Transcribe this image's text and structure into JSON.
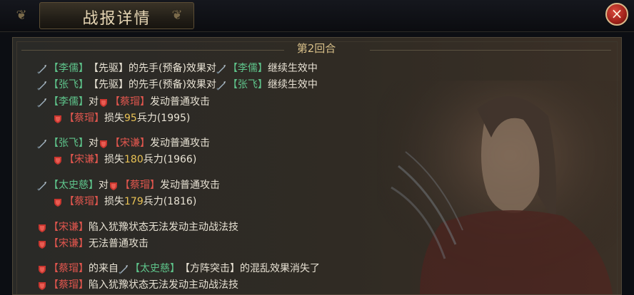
{
  "window": {
    "title": "战报详情",
    "close_label": "×"
  },
  "round": {
    "label": "第2回合"
  },
  "log": [
    {
      "icon": "sword",
      "parts": [
        {
          "t": "【李儒】",
          "c": "green"
        },
        {
          "t": "【先驱】的先手(预备)效果对",
          "c": "white"
        },
        {
          "icon": "sword"
        },
        {
          "t": "【李儒】",
          "c": "green"
        },
        {
          "t": "继续生效中",
          "c": "white"
        }
      ]
    },
    {
      "icon": "sword",
      "parts": [
        {
          "t": "【张飞】",
          "c": "green"
        },
        {
          "t": "【先驱】的先手(预备)效果对",
          "c": "white"
        },
        {
          "icon": "sword"
        },
        {
          "t": "【张飞】",
          "c": "green"
        },
        {
          "t": "继续生效中",
          "c": "white"
        }
      ]
    },
    {
      "icon": "sword",
      "parts": [
        {
          "t": "【李儒】",
          "c": "green"
        },
        {
          "t": "对",
          "c": "white"
        },
        {
          "icon": "shield"
        },
        {
          "t": "【蔡瑁】",
          "c": "red"
        },
        {
          "t": "发动普通攻击",
          "c": "white"
        }
      ]
    },
    {
      "icon": "shield",
      "indent": true,
      "parts": [
        {
          "t": "【蔡瑁】",
          "c": "red"
        },
        {
          "t": "损失",
          "c": "white"
        },
        {
          "t": "95",
          "c": "num"
        },
        {
          "t": "兵力(1995)",
          "c": "white"
        }
      ]
    },
    {
      "icon": "sword",
      "parts": [
        {
          "t": "【张飞】",
          "c": "green"
        },
        {
          "t": "对",
          "c": "white"
        },
        {
          "icon": "shield"
        },
        {
          "t": "【宋谦】",
          "c": "red"
        },
        {
          "t": "发动普通攻击",
          "c": "white"
        }
      ]
    },
    {
      "icon": "shield",
      "indent": true,
      "parts": [
        {
          "t": "【宋谦】",
          "c": "red"
        },
        {
          "t": "损失",
          "c": "white"
        },
        {
          "t": "180",
          "c": "num"
        },
        {
          "t": "兵力(1966)",
          "c": "white"
        }
      ]
    },
    {
      "icon": "sword",
      "parts": [
        {
          "t": "【太史慈】",
          "c": "green"
        },
        {
          "t": "对",
          "c": "white"
        },
        {
          "icon": "shield"
        },
        {
          "t": "【蔡瑁】",
          "c": "red"
        },
        {
          "t": "发动普通攻击",
          "c": "white"
        }
      ]
    },
    {
      "icon": "shield",
      "indent": true,
      "parts": [
        {
          "t": "【蔡瑁】",
          "c": "red"
        },
        {
          "t": "损失",
          "c": "white"
        },
        {
          "t": "179",
          "c": "num"
        },
        {
          "t": "兵力(1816)",
          "c": "white"
        }
      ]
    },
    {
      "icon": "shield",
      "parts": [
        {
          "t": "【宋谦】",
          "c": "red"
        },
        {
          "t": "陷入犹豫状态无法发动主动战法技",
          "c": "white"
        }
      ]
    },
    {
      "icon": "shield",
      "parts": [
        {
          "t": "【宋谦】",
          "c": "red"
        },
        {
          "t": "无法普通攻击",
          "c": "white"
        }
      ]
    },
    {
      "icon": "shield",
      "parts": [
        {
          "t": "【蔡瑁】",
          "c": "red"
        },
        {
          "t": "的来自",
          "c": "white"
        },
        {
          "icon": "sword"
        },
        {
          "t": "【太史慈】",
          "c": "green"
        },
        {
          "t": "【方阵突击】的混乱效果消失了",
          "c": "white"
        }
      ]
    },
    {
      "icon": "shield",
      "parts": [
        {
          "t": "【蔡瑁】",
          "c": "red"
        },
        {
          "t": "陷入犹豫状态无法发动主动战法技",
          "c": "white"
        }
      ]
    }
  ],
  "colors": {
    "ally": "#5ec38a",
    "enemy": "#e2564e",
    "number": "#e9c255",
    "text": "#e8e2d4"
  }
}
